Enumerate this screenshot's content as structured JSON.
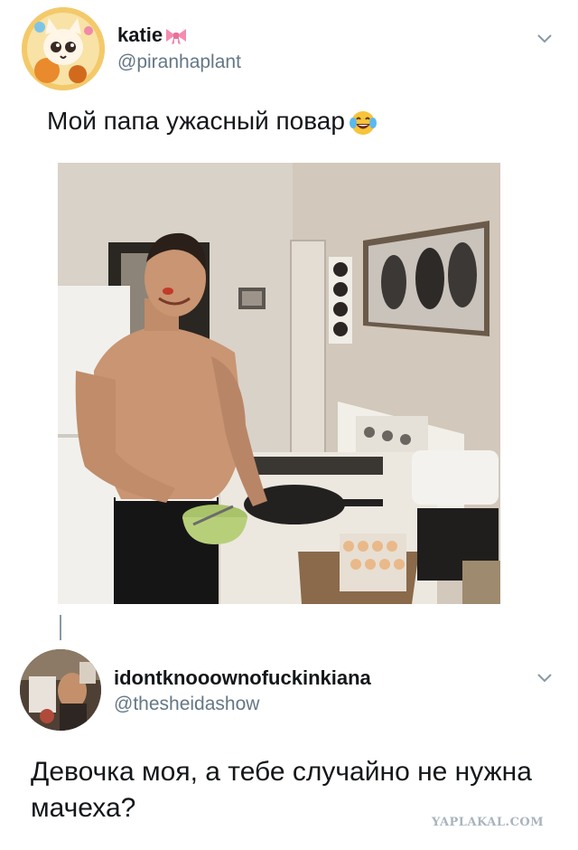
{
  "tweet1": {
    "display_name": "katie",
    "name_icon": "pink-bow-emoji",
    "handle": "@piranhaplant",
    "text": "Мой папа ужасный повар",
    "text_emoji": "tears-of-joy-emoji",
    "menu_icon": "chevron-down-icon",
    "media": "photo"
  },
  "tweet2": {
    "display_name": "idontknooownofuckinkiana",
    "handle": "@thesheidashow",
    "text": "Девочка моя, а тебе случайно не нужна мачеха?",
    "menu_icon": "chevron-down-icon"
  },
  "watermark": "YAPLAKAL.COM",
  "colors": {
    "text": "#14171a",
    "secondary": "#657786",
    "thread_line": "#8899a6",
    "bow": "#f58bb0"
  }
}
